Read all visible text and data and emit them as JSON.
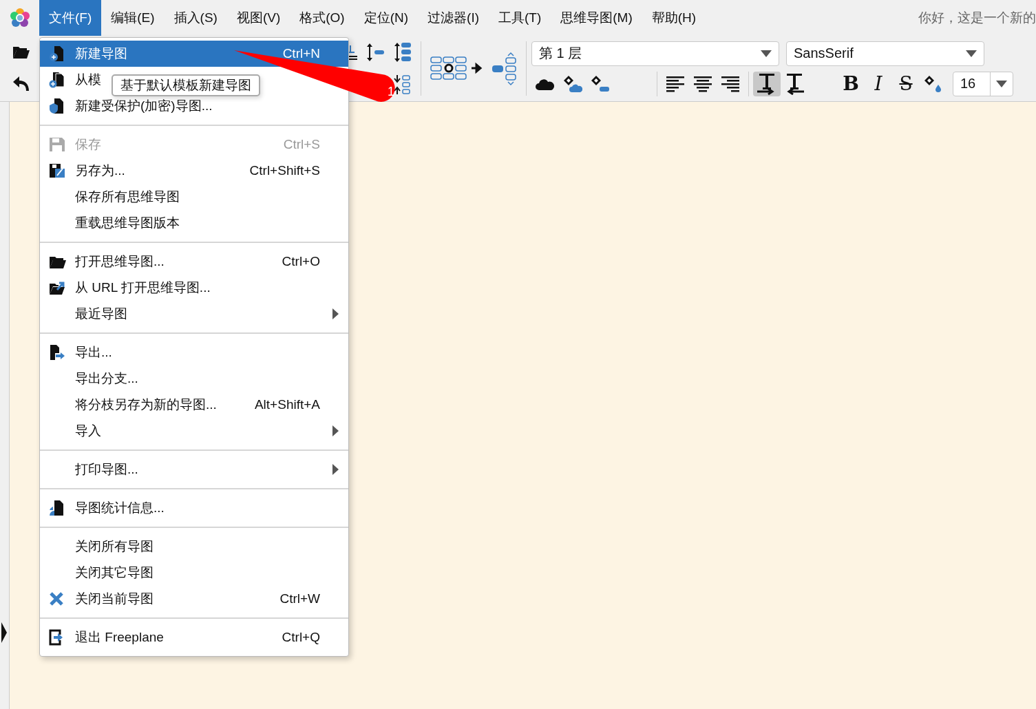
{
  "menubar": {
    "items": [
      {
        "label": "文件(F)",
        "selected": true
      },
      {
        "label": "编辑(E)",
        "selected": false
      },
      {
        "label": "插入(S)",
        "selected": false
      },
      {
        "label": "视图(V)",
        "selected": false
      },
      {
        "label": "格式(O)",
        "selected": false
      },
      {
        "label": "定位(N)",
        "selected": false
      },
      {
        "label": "过滤器(I)",
        "selected": false
      },
      {
        "label": "工具(T)",
        "selected": false
      },
      {
        "label": "思维导图(M)",
        "selected": false
      },
      {
        "label": "帮助(H)",
        "selected": false
      }
    ],
    "title": "你好，这是一个新的"
  },
  "toolbar": {
    "level_combo": {
      "value": "第 1 层"
    },
    "font_combo": {
      "value": "SansSerif"
    },
    "size_spinner": {
      "value": "16"
    },
    "direction_toggles": [
      {
        "selected": true
      },
      {
        "selected": false
      }
    ],
    "format_buttons": [
      {
        "label": "B",
        "kind": "bold"
      },
      {
        "label": "I",
        "kind": "italic"
      },
      {
        "label": "S",
        "kind": "strike"
      }
    ]
  },
  "file_menu": {
    "groups": [
      {
        "items": [
          {
            "label": "新建导图",
            "shortcut": "Ctrl+N",
            "selected": true,
            "disabled": false,
            "submenu": false
          },
          {
            "label": "从模",
            "selected": false,
            "disabled": false,
            "submenu": false
          },
          {
            "label": "新建受保护(加密)导图...",
            "selected": false,
            "disabled": false,
            "submenu": false
          }
        ]
      },
      {
        "items": [
          {
            "label": "保存",
            "shortcut": "Ctrl+S",
            "selected": false,
            "disabled": true,
            "submenu": false
          },
          {
            "label": "另存为...",
            "shortcut": "Ctrl+Shift+S",
            "selected": false,
            "disabled": false,
            "submenu": false
          },
          {
            "label": "保存所有思维导图",
            "selected": false,
            "disabled": false,
            "submenu": false
          },
          {
            "label": "重载思维导图版本",
            "selected": false,
            "disabled": false,
            "submenu": false
          }
        ]
      },
      {
        "items": [
          {
            "label": "打开思维导图...",
            "shortcut": "Ctrl+O",
            "selected": false,
            "disabled": false,
            "submenu": false
          },
          {
            "label": "从 URL 打开思维导图...",
            "selected": false,
            "disabled": false,
            "submenu": false
          },
          {
            "label": "最近导图",
            "selected": false,
            "disabled": false,
            "submenu": true
          }
        ]
      },
      {
        "items": [
          {
            "label": "导出...",
            "selected": false,
            "disabled": false,
            "submenu": false
          },
          {
            "label": "导出分支...",
            "selected": false,
            "disabled": false,
            "submenu": false
          },
          {
            "label": "将分枝另存为新的导图...",
            "shortcut": "Alt+Shift+A",
            "selected": false,
            "disabled": false,
            "submenu": false
          },
          {
            "label": "导入",
            "selected": false,
            "disabled": false,
            "submenu": true
          }
        ]
      },
      {
        "items": [
          {
            "label": "打印导图...",
            "selected": false,
            "disabled": false,
            "submenu": true
          }
        ]
      },
      {
        "items": [
          {
            "label": "导图统计信息...",
            "selected": false,
            "disabled": false,
            "submenu": false
          }
        ]
      },
      {
        "items": [
          {
            "label": "关闭所有导图",
            "selected": false,
            "disabled": false,
            "submenu": false
          },
          {
            "label": "关闭其它导图",
            "selected": false,
            "disabled": false,
            "submenu": false
          },
          {
            "label": "关闭当前导图",
            "shortcut": "Ctrl+W",
            "selected": false,
            "disabled": false,
            "submenu": false
          }
        ]
      },
      {
        "items": [
          {
            "label": "退出 Freeplane",
            "shortcut": "Ctrl+Q",
            "selected": false,
            "disabled": false,
            "submenu": false
          }
        ]
      }
    ]
  },
  "tooltip": {
    "text": "基于默认模板新建导图"
  },
  "annotation": {
    "label": "1"
  }
}
